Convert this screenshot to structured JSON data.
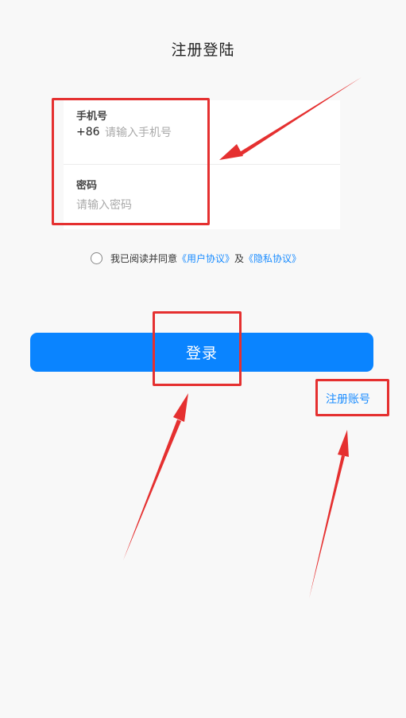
{
  "header": {
    "title": "注册登陆"
  },
  "form": {
    "phone": {
      "label": "手机号",
      "country_code": "+86",
      "placeholder": "请输入手机号",
      "value": ""
    },
    "password": {
      "label": "密码",
      "placeholder": "请输入密码",
      "value": ""
    }
  },
  "agreement": {
    "checked": false,
    "prefix": "我已阅读并同意",
    "user_agreement": "《用户协议》",
    "conjunction": "及",
    "privacy_agreement": "《隐私协议》"
  },
  "actions": {
    "login_label": "登录",
    "register_label": "注册账号"
  },
  "colors": {
    "accent": "#0a84ff",
    "link": "#1a8cff",
    "annotation": "#e53030",
    "background": "#f8f8f8"
  }
}
